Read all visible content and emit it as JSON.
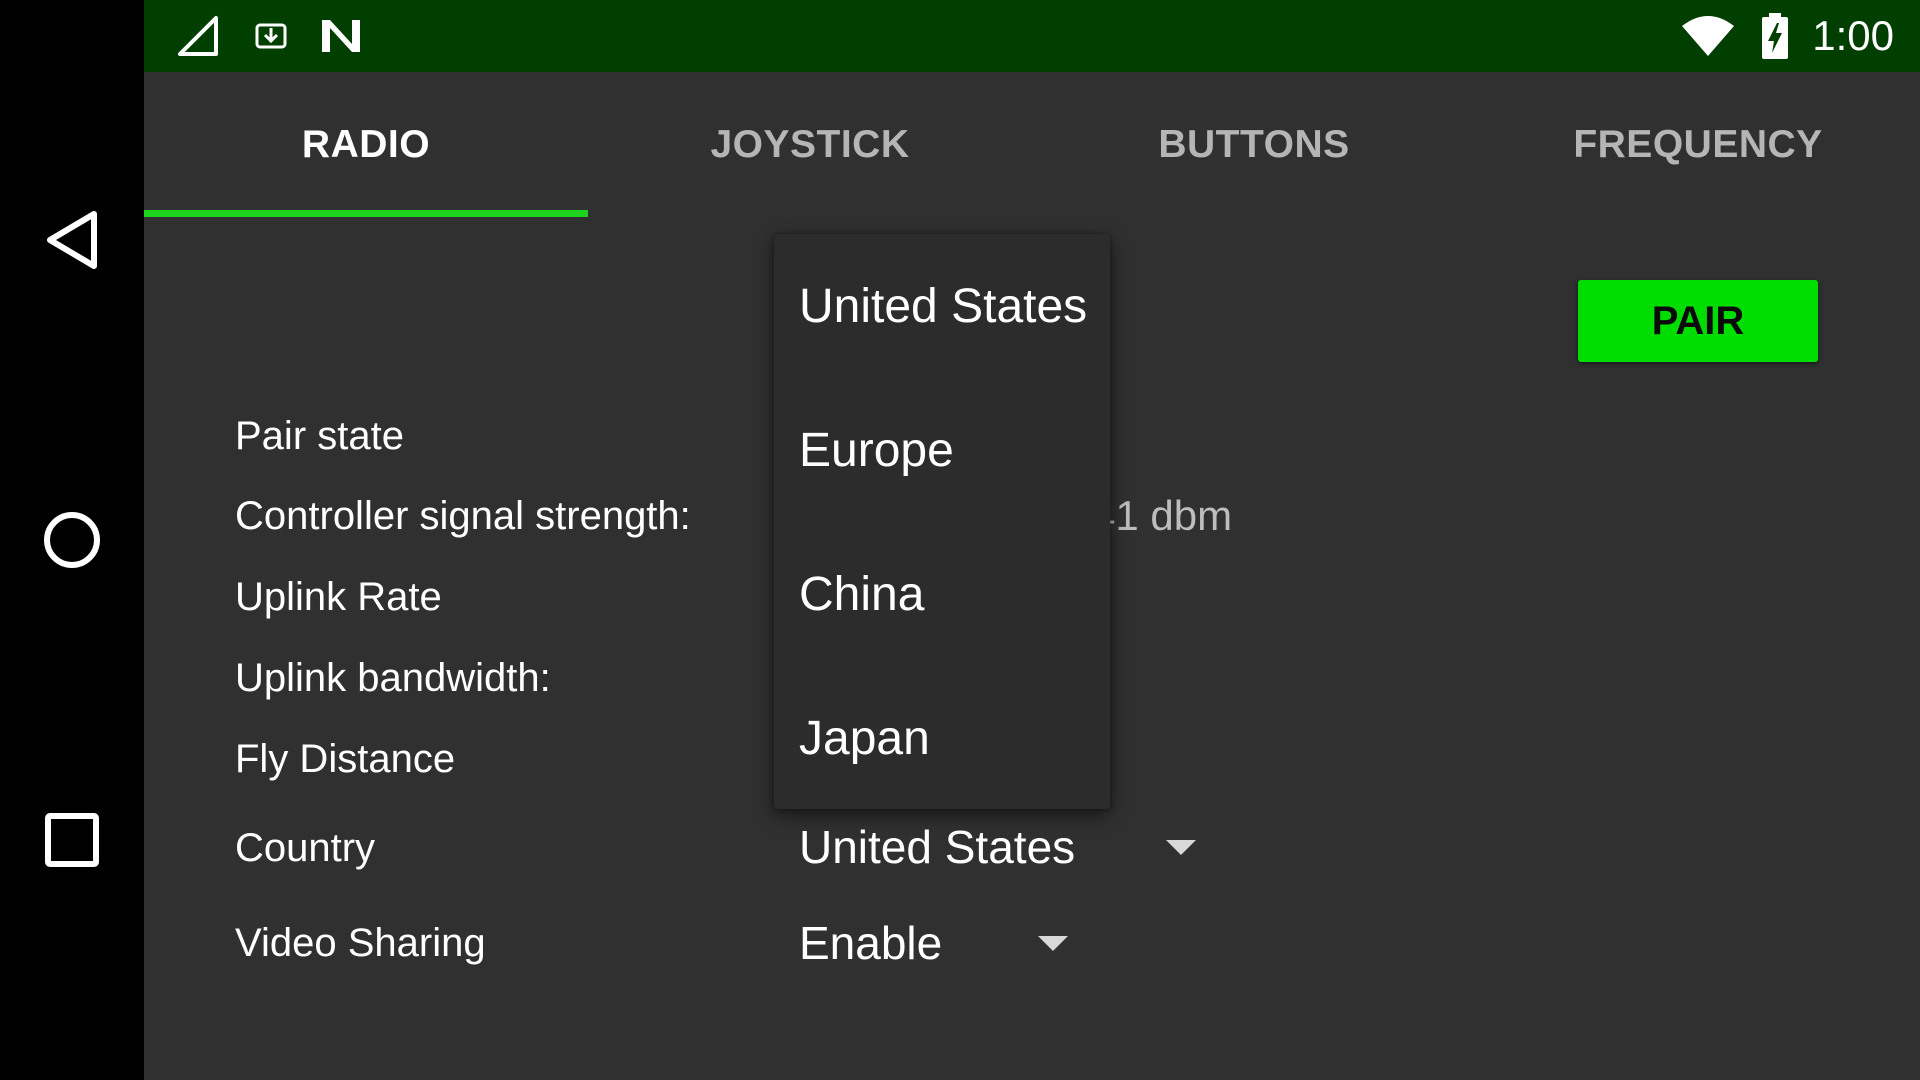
{
  "status_bar": {
    "time": "1:00",
    "icons": [
      "signal-icon",
      "download-icon",
      "n-logo-icon",
      "wifi-icon",
      "battery-charging-icon"
    ]
  },
  "navigation": {
    "icons": [
      "back-icon",
      "home-icon",
      "recents-icon"
    ]
  },
  "tabs": [
    {
      "label": "RADIO",
      "active": true
    },
    {
      "label": "JOYSTICK",
      "active": false
    },
    {
      "label": "BUTTONS",
      "active": false
    },
    {
      "label": "FREQUENCY",
      "active": false
    }
  ],
  "pair_button": {
    "label": "PAIR"
  },
  "rows": {
    "pair_state": {
      "label": "Pair state"
    },
    "signal_strength": {
      "label": "Controller signal strength:",
      "value": "41 dbm"
    },
    "uplink_rate": {
      "label": "Uplink Rate"
    },
    "uplink_bandwidth": {
      "label": "Uplink bandwidth:"
    },
    "fly_distance": {
      "label": "Fly Distance"
    },
    "country": {
      "label": "Country",
      "selected": "United States"
    },
    "video_sharing": {
      "label": "Video Sharing",
      "selected": "Enable"
    }
  },
  "country_dropdown": {
    "options": [
      "United States",
      "Europe",
      "China",
      "Japan"
    ]
  },
  "colors": {
    "accent": "#1ed31e",
    "pair_button": "#00dd00",
    "status_bar": "#003f00",
    "background": "#303030"
  }
}
